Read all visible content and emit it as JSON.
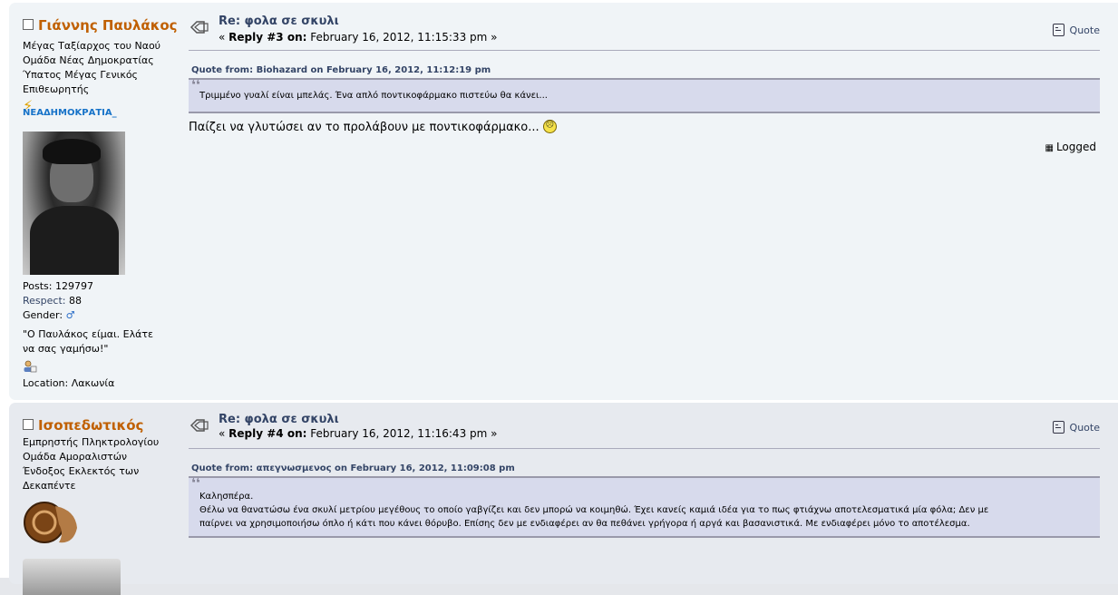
{
  "posts": [
    {
      "author": "Γιάννης Παυλάκος",
      "titles": [
        "Μέγας Ταξίαρχος του Ναού",
        "Ομάδα Νέας Δημοκρατίας",
        "Ύπατος Μέγας Γενικός",
        "Επιθεωρητής"
      ],
      "logo_text": "ΝΕΑΔΗΜΟΚΡΑΤΙΑ_",
      "posts_label": "Posts:",
      "posts_count": "129797",
      "respect_label": "Respect:",
      "respect_count": "88",
      "gender_label": "Gender:",
      "gender_icon": "male-icon",
      "signature_line1": "\"Ο Παυλάκος είμαι. Ελάτε",
      "signature_line2": "να σας γαμήσω!\"",
      "location_label": "Location:",
      "location": "Λακωνία",
      "subject": "Re: φολα σε σκυλι",
      "reply_prefix": "«",
      "reply_label": "Reply #3 on:",
      "reply_date": "February 16, 2012, 11:15:33 pm »",
      "quote_label": "Quote",
      "quote_header": "Quote from: Biohazard on February 16, 2012, 11:12:19 pm",
      "quote_text": "Τριμμένο γυαλί είναι μπελάς. Ένα απλό ποντικοφάρμακο πιστεύω θα κάνει...",
      "body": "Παίζει να γλυτώσει αν το προλάβουν με ποντικοφάρμακο...",
      "logged_label": "Logged"
    },
    {
      "author": "Ισοπεδωτικός",
      "titles": [
        "Εμπρηστής Πληκτρολογίου",
        "Ομάδα Αμοραλιστών",
        "Ένδοξος Εκλεκτός των",
        "Δεκαπέντε"
      ],
      "subject": "Re: φολα σε σκυλι",
      "reply_prefix": "«",
      "reply_label": "Reply #4 on:",
      "reply_date": "February 16, 2012, 11:16:43 pm »",
      "quote_label": "Quote",
      "quote_header": "Quote from: απεγνωσμενος on February 16, 2012, 11:09:08 pm",
      "quote_lines": [
        "Καλησπέρα.",
        "Θέλω να θανατώσω ένα σκυλί μετρίου μεγέθους το οποίο γαβγίζει και δεν μπορώ να κοιμηθώ. Έχει κανείς καμιά ιδέα για το πως φτιάχνω αποτελεσματικά μία φόλα; Δεν με",
        "παίρνει να χρησιμοποιήσω όπλο ή κάτι που κάνει θόρυβο. Επίσης δεν με ενδιαφέρει αν θα πεθάνει γρήγορα ή αργά και βασανιστικά. Με ενδιαφέρει μόνο το αποτέλεσμα."
      ]
    }
  ]
}
